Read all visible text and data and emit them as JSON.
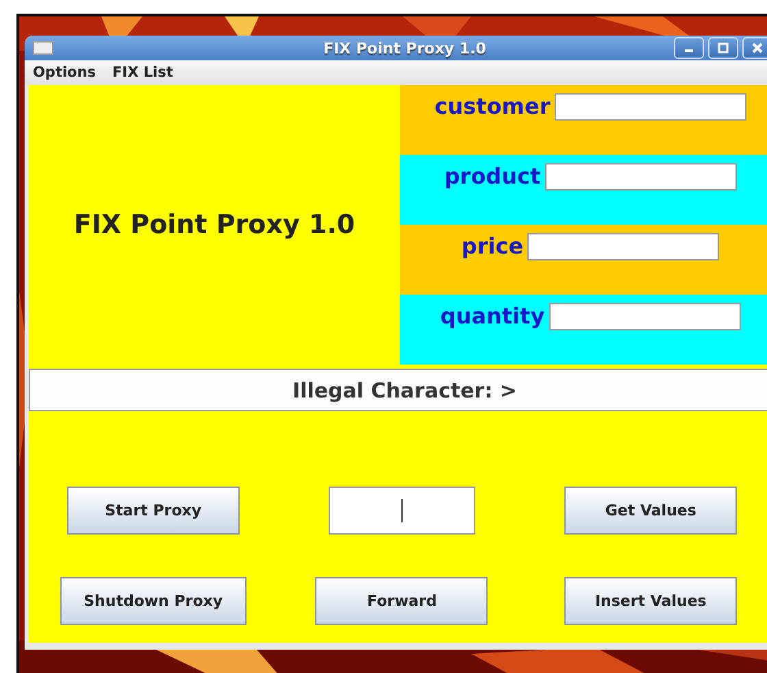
{
  "window": {
    "title": "FIX Point Proxy 1.0"
  },
  "menu": [
    "Options",
    "FIX List"
  ],
  "heading": "FIX Point Proxy 1.0",
  "fields": [
    {
      "label": "customer",
      "color": "#ffcc00"
    },
    {
      "label": "product",
      "color": "#00ffff"
    },
    {
      "label": "price",
      "color": "#ffcc00"
    },
    {
      "label": "quantity",
      "color": "#00ffff"
    }
  ],
  "status": "Illegal Character: >",
  "controls": [
    {
      "kind": "button",
      "label": "Start Proxy"
    },
    {
      "kind": "field",
      "focused": true
    },
    {
      "kind": "button",
      "label": "Get Values"
    },
    {
      "kind": "button",
      "label": "Shutdown Proxy"
    },
    {
      "kind": "button",
      "label": "Forward"
    },
    {
      "kind": "button",
      "label": "Insert Values"
    }
  ]
}
